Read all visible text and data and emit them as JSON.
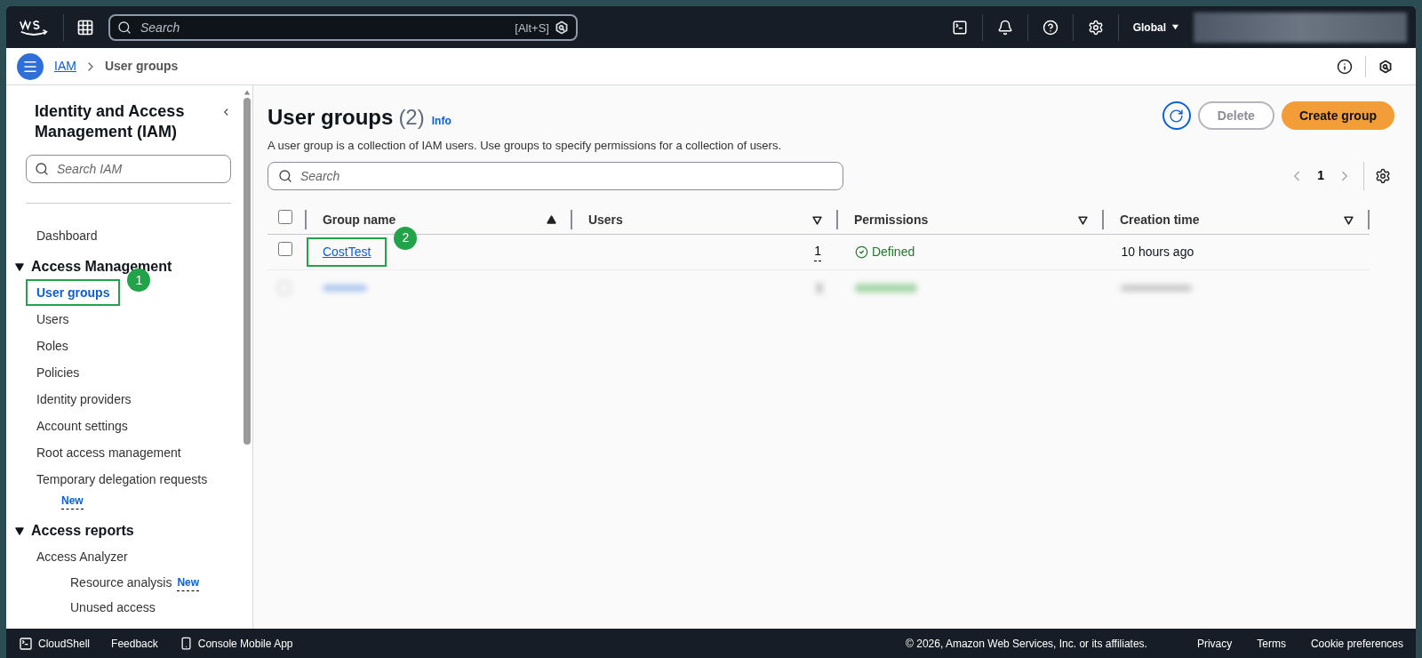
{
  "top_bar": {
    "search": {
      "placeholder": "Search",
      "shortcut": "[Alt+S]"
    },
    "region": "Global"
  },
  "breadcrumb": [
    {
      "label": "IAM",
      "kind": "link"
    },
    {
      "label": "User groups",
      "kind": "current"
    }
  ],
  "sidebar": {
    "title": "Identity and Access Management (IAM)",
    "search": {
      "placeholder": "Search IAM"
    },
    "items": [
      {
        "kind": "link",
        "label": "Dashboard",
        "selected": false
      },
      {
        "kind": "section",
        "label": "Access Management",
        "expanded": true,
        "children": [
          {
            "label": "User groups",
            "selected": true,
            "callout": "1"
          },
          {
            "label": "Users",
            "selected": false
          },
          {
            "label": "Roles",
            "selected": false
          },
          {
            "label": "Policies",
            "selected": false
          },
          {
            "label": "Identity providers",
            "selected": false
          },
          {
            "label": "Account settings",
            "selected": false
          },
          {
            "label": "Root access management",
            "selected": false
          },
          {
            "label": "Temporary delegation requests",
            "selected": false,
            "badge": "New"
          }
        ]
      },
      {
        "kind": "section",
        "label": "Access reports",
        "expanded": true,
        "children": [
          {
            "label": "Access Analyzer",
            "selected": false,
            "children": [
              {
                "label": "Resource analysis",
                "selected": false,
                "badge": "New"
              },
              {
                "label": "Unused access",
                "selected": false
              }
            ]
          }
        ]
      }
    ]
  },
  "page": {
    "title": "User groups",
    "count": "(2)",
    "info": "Info",
    "description": "A user group is a collection of IAM users. Use groups to specify permissions for a collection of users.",
    "buttons": [
      {
        "label": "Delete",
        "disabled": true
      },
      {
        "label": "Create group",
        "disabled": false
      }
    ],
    "search": {
      "placeholder": "Search"
    },
    "pagination": {
      "page": "1"
    }
  },
  "table": {
    "select_all_checked": false,
    "columns": [
      {
        "label": "Group name",
        "sorted": true
      },
      {
        "label": "Users",
        "sorted": false
      },
      {
        "label": "Permissions",
        "sorted": false
      },
      {
        "label": "Creation time",
        "sorted": false
      }
    ],
    "rows": [
      {
        "kind": "group",
        "name": "CostTest",
        "users": "1",
        "permissions": "Defined",
        "created": "10 hours ago",
        "checked": false,
        "callout": "2"
      },
      {
        "kind": "redacted",
        "checked": false
      }
    ]
  },
  "footer": {
    "left": [
      "CloudShell",
      "Feedback",
      "Console Mobile App"
    ],
    "copyright": "© 2026, Amazon Web Services, Inc. or its affiliates.",
    "right": [
      "Privacy",
      "Terms",
      "Cookie preferences"
    ]
  }
}
